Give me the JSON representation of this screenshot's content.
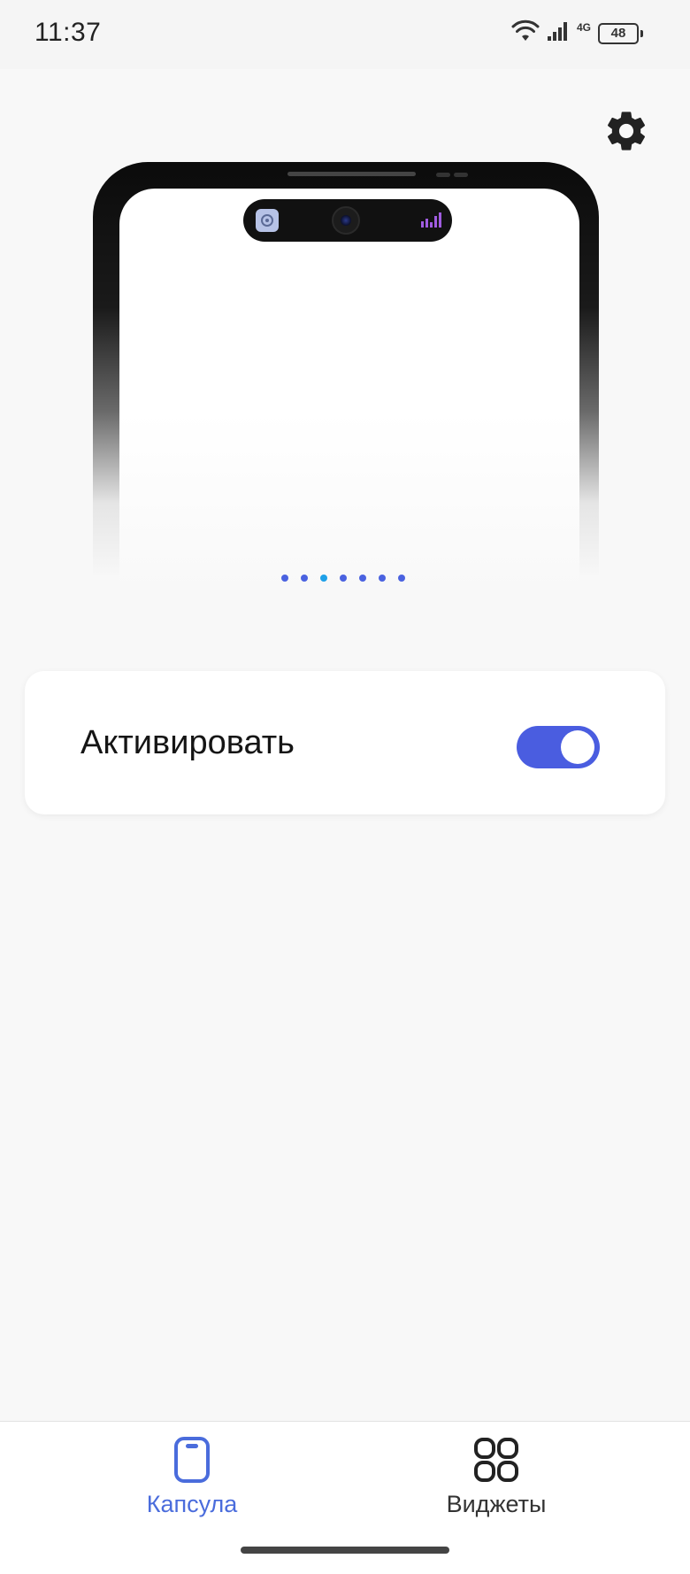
{
  "status_bar": {
    "time": "11:37",
    "network_label": "4G",
    "battery": "48",
    "icons": [
      "wifi-icon",
      "signal-icon",
      "battery-icon"
    ]
  },
  "header": {
    "settings_icon": "gear-icon"
  },
  "preview": {
    "page_count": 7,
    "active_page": 3,
    "capsule_icons": [
      "app-icon",
      "camera-icon",
      "equalizer-icon"
    ]
  },
  "activate": {
    "label": "Активировать",
    "enabled": true
  },
  "bottom_nav": {
    "items": [
      {
        "label": "Капсула",
        "icon": "phone-outline-icon",
        "active": true
      },
      {
        "label": "Виджеты",
        "icon": "widgets-grid-icon",
        "active": false
      }
    ]
  },
  "colors": {
    "accent": "#4a5de0",
    "accent_text": "#4a6cdc",
    "active_dot": "#1ea0e8",
    "background": "#f8f8f8",
    "equalizer": "#a05ce0"
  }
}
